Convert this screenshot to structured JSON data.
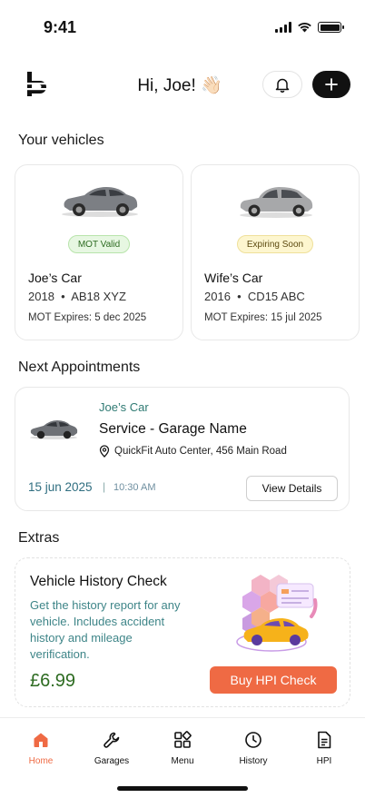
{
  "status_bar": {
    "time": "9:41"
  },
  "header": {
    "greeting": "Hi, Joe! 👋🏻"
  },
  "sections": {
    "vehicles": "Your vehicles",
    "appointments": "Next Appointments",
    "extras": "Extras"
  },
  "vehicles": [
    {
      "badge": "MOT Valid",
      "name": "Joe’s Car",
      "info": "2018  •  AB18 XYZ",
      "mot": "MOT Expires: 5 dec 2025",
      "color": "#7c7f84"
    },
    {
      "badge": "Expiring Soon",
      "name": "Wife’s Car",
      "info": "2016  •  CD15 ABC",
      "mot": "MOT Expires: 15 jul 2025",
      "color": "#a7a8aa"
    }
  ],
  "appointment": {
    "car_name": "Joe’s Car",
    "service": "Service - Garage Name",
    "address": "QuickFit Auto Center, 456 Main Road",
    "date": "15 jun 2025",
    "separator": "|",
    "time": "10:30 AM",
    "details_label": "View Details"
  },
  "extras": {
    "title": "Vehicle History Check",
    "description": "Get the history report for any vehicle. Includes accident history and mileage verification.",
    "price": "£6.99",
    "button_label": "Buy HPI Check"
  },
  "nav": [
    {
      "label": "Home",
      "icon": "home-icon",
      "active": true
    },
    {
      "label": "Garages",
      "icon": "wrench-icon",
      "active": false
    },
    {
      "label": "Menu",
      "icon": "grid-icon",
      "active": false
    },
    {
      "label": "History",
      "icon": "clock-icon",
      "active": false
    },
    {
      "label": "HPI",
      "icon": "document-icon",
      "active": false
    }
  ],
  "colors": {
    "accent": "#ef6a44",
    "teal": "#2f7a73",
    "price_green": "#2d6b21"
  }
}
